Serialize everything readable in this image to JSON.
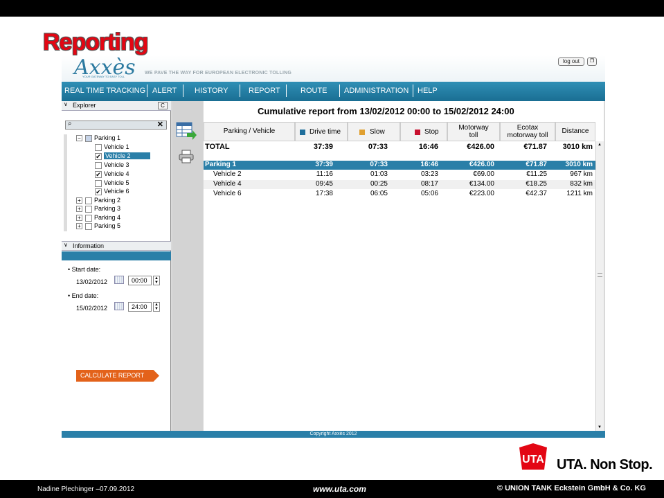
{
  "slide": {
    "title": "Reporting",
    "author": "Nadine Plechinger –07.09.2012",
    "site": "www.uta.com",
    "copyright": "© UNION TANK Eckstein GmbH & Co. KG",
    "uta_slogan": "UTA. Non Stop.",
    "uta_logo_text": "UTA"
  },
  "app": {
    "logo": "Axxès",
    "logo_sub": "YOUR GATEWAY TO EASY TOLL",
    "tagline": "WE PAVE THE WAY FOR EUROPEAN ELECTRONIC TOLLING",
    "logout_label": "log out",
    "nav": [
      "REAL TIME TRACKING",
      "ALERT",
      "HISTORY",
      "REPORT",
      "ROUTE",
      "ADMINISTRATION",
      "HELP"
    ],
    "footer": "Copyright Axxès 2012"
  },
  "explorer": {
    "title": "Explorer",
    "search_placeholder": "",
    "tree": [
      {
        "label": "Parking 1",
        "type": "group",
        "expanded": true,
        "checked": "partial"
      },
      {
        "label": "Vehicle 1",
        "type": "vehicle",
        "checked": false
      },
      {
        "label": "Vehicle 2",
        "type": "vehicle",
        "checked": true,
        "selected": true
      },
      {
        "label": "Vehicle 3",
        "type": "vehicle",
        "checked": false
      },
      {
        "label": "Vehicle 4",
        "type": "vehicle",
        "checked": true
      },
      {
        "label": "Vehicle 5",
        "type": "vehicle",
        "checked": false
      },
      {
        "label": "Vehicle 6",
        "type": "vehicle",
        "checked": true
      },
      {
        "label": "Parking 2",
        "type": "group",
        "expanded": false,
        "checked": false
      },
      {
        "label": "Parking 3",
        "type": "group",
        "expanded": false,
        "checked": false
      },
      {
        "label": "Parking 4",
        "type": "group",
        "expanded": false,
        "checked": false
      },
      {
        "label": "Parking 5",
        "type": "group",
        "expanded": false,
        "checked": false
      }
    ]
  },
  "information": {
    "title": "Information",
    "start_label": "Start date:",
    "start_date": "13/02/2012",
    "start_time": "00:00",
    "end_label": "End date:",
    "end_date": "15/02/2012",
    "end_time": "24:00",
    "calculate_label": "CALCULATE REPORT"
  },
  "report": {
    "title": "Cumulative report from 13/02/2012 00:00 to 15/02/2012 24:00",
    "columns": {
      "name": "Parking / Vehicle",
      "drive": "Drive time",
      "slow": "Slow",
      "stop": "Stop",
      "motorway1": "Motorway",
      "motorway2": "toll",
      "ecotax1": "Ecotax",
      "ecotax2": "motorway toll",
      "distance": "Distance"
    },
    "colors": {
      "drive": "#1f6f9c",
      "slow": "#e0a030",
      "stop": "#c8102e",
      "accent": "#2a7fa8"
    },
    "rows": [
      {
        "kind": "total",
        "name": "TOTAL",
        "drive": "37:39",
        "slow": "07:33",
        "stop": "16:46",
        "motorway": "€426.00",
        "ecotax": "€71.87",
        "distance": "3010 km"
      },
      {
        "kind": "parking",
        "name": "Parking 1",
        "drive": "37:39",
        "slow": "07:33",
        "stop": "16:46",
        "motorway": "€426.00",
        "ecotax": "€71.87",
        "distance": "3010 km"
      },
      {
        "kind": "vehicle",
        "name": "Vehicle 2",
        "drive": "11:16",
        "slow": "01:03",
        "stop": "03:23",
        "motorway": "€69.00",
        "ecotax": "€11.25",
        "distance": "967 km"
      },
      {
        "kind": "vehicle",
        "name": "Vehicle 4",
        "drive": "09:45",
        "slow": "00:25",
        "stop": "08:17",
        "motorway": "€134.00",
        "ecotax": "€18.25",
        "distance": "832 km"
      },
      {
        "kind": "vehicle",
        "name": "Vehicle 6",
        "drive": "17:38",
        "slow": "06:05",
        "stop": "05:06",
        "motorway": "€223.00",
        "ecotax": "€42.37",
        "distance": "1211 km"
      }
    ]
  }
}
